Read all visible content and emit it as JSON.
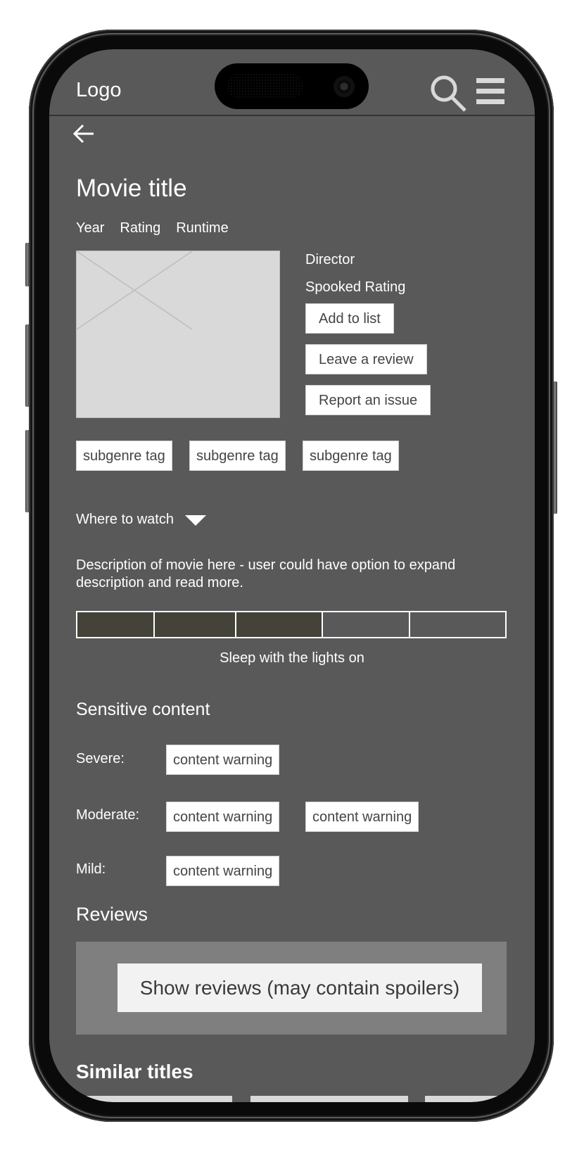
{
  "header": {
    "logo": "Logo",
    "search_icon": "search-icon",
    "menu_icon": "hamburger-menu-icon"
  },
  "nav": {
    "back_icon": "arrow-left-icon"
  },
  "movie": {
    "title": "Movie title",
    "meta": [
      "Year",
      "Rating",
      "Runtime"
    ],
    "poster_icon": "image-placeholder-icon",
    "director": "Director",
    "spooked_rating": "Spooked Rating",
    "actions": [
      "Add to list",
      "Leave a review",
      "Report an issue"
    ],
    "subgenre_tags": [
      "subgenre tag",
      "subgenre tag",
      "subgenre tag"
    ],
    "where_to_watch": "Where to watch",
    "where_to_watch_icon": "caret-down-icon",
    "description": "Description of movie here - user could have option to expand description and read more."
  },
  "scare_meter": {
    "filled_segments": 3,
    "total_segments": 5,
    "label": "Sleep with the lights on",
    "colors": {
      "filled": "#45423a",
      "empty": "#595959",
      "border": "#ffffff"
    }
  },
  "sensitive_content": {
    "heading": "Sensitive content",
    "levels": [
      {
        "label": "Severe:",
        "warnings": [
          "content warning"
        ]
      },
      {
        "label": "Moderate:",
        "warnings": [
          "content warning",
          "content warning"
        ]
      },
      {
        "label": "Mild:",
        "warnings": [
          "content warning"
        ]
      }
    ]
  },
  "reviews": {
    "heading": "Reviews",
    "show_button": "Show reviews (may contain spoilers)"
  },
  "similar_titles": {
    "heading": "Similar titles",
    "card_count_visible": 3
  },
  "colors": {
    "screen_bg": "#595959",
    "reviews_panel": "#7f7f7f",
    "button_bg": "#ffffff",
    "placeholder": "#d9d9d9"
  }
}
